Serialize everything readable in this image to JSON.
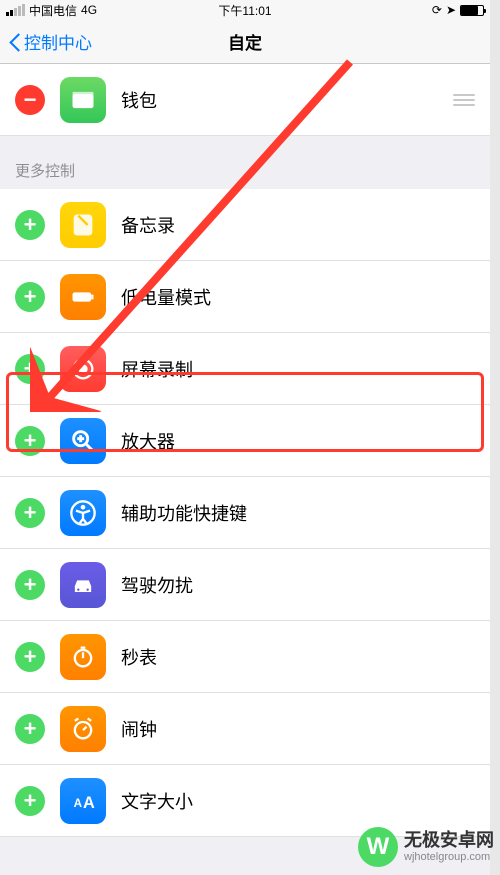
{
  "status": {
    "carrier": "中国电信",
    "network": "4G",
    "time": "下午11:01"
  },
  "nav": {
    "back": "控制中心",
    "title": "自定"
  },
  "included": [
    {
      "label": "钱包",
      "icon": "wallet"
    }
  ],
  "section_more": "更多控制",
  "more": [
    {
      "label": "备忘录",
      "icon": "notes"
    },
    {
      "label": "低电量模式",
      "icon": "lowpower"
    },
    {
      "label": "屏幕录制",
      "icon": "screenrec"
    },
    {
      "label": "放大器",
      "icon": "magnifier"
    },
    {
      "label": "辅助功能快捷键",
      "icon": "accessibility"
    },
    {
      "label": "驾驶勿扰",
      "icon": "dnd"
    },
    {
      "label": "秒表",
      "icon": "stopwatch"
    },
    {
      "label": "闹钟",
      "icon": "alarm"
    },
    {
      "label": "文字大小",
      "icon": "textsize"
    }
  ],
  "watermark": {
    "brand": "无极安卓网",
    "url": "wjhotelgroup.com",
    "logo": "W"
  }
}
